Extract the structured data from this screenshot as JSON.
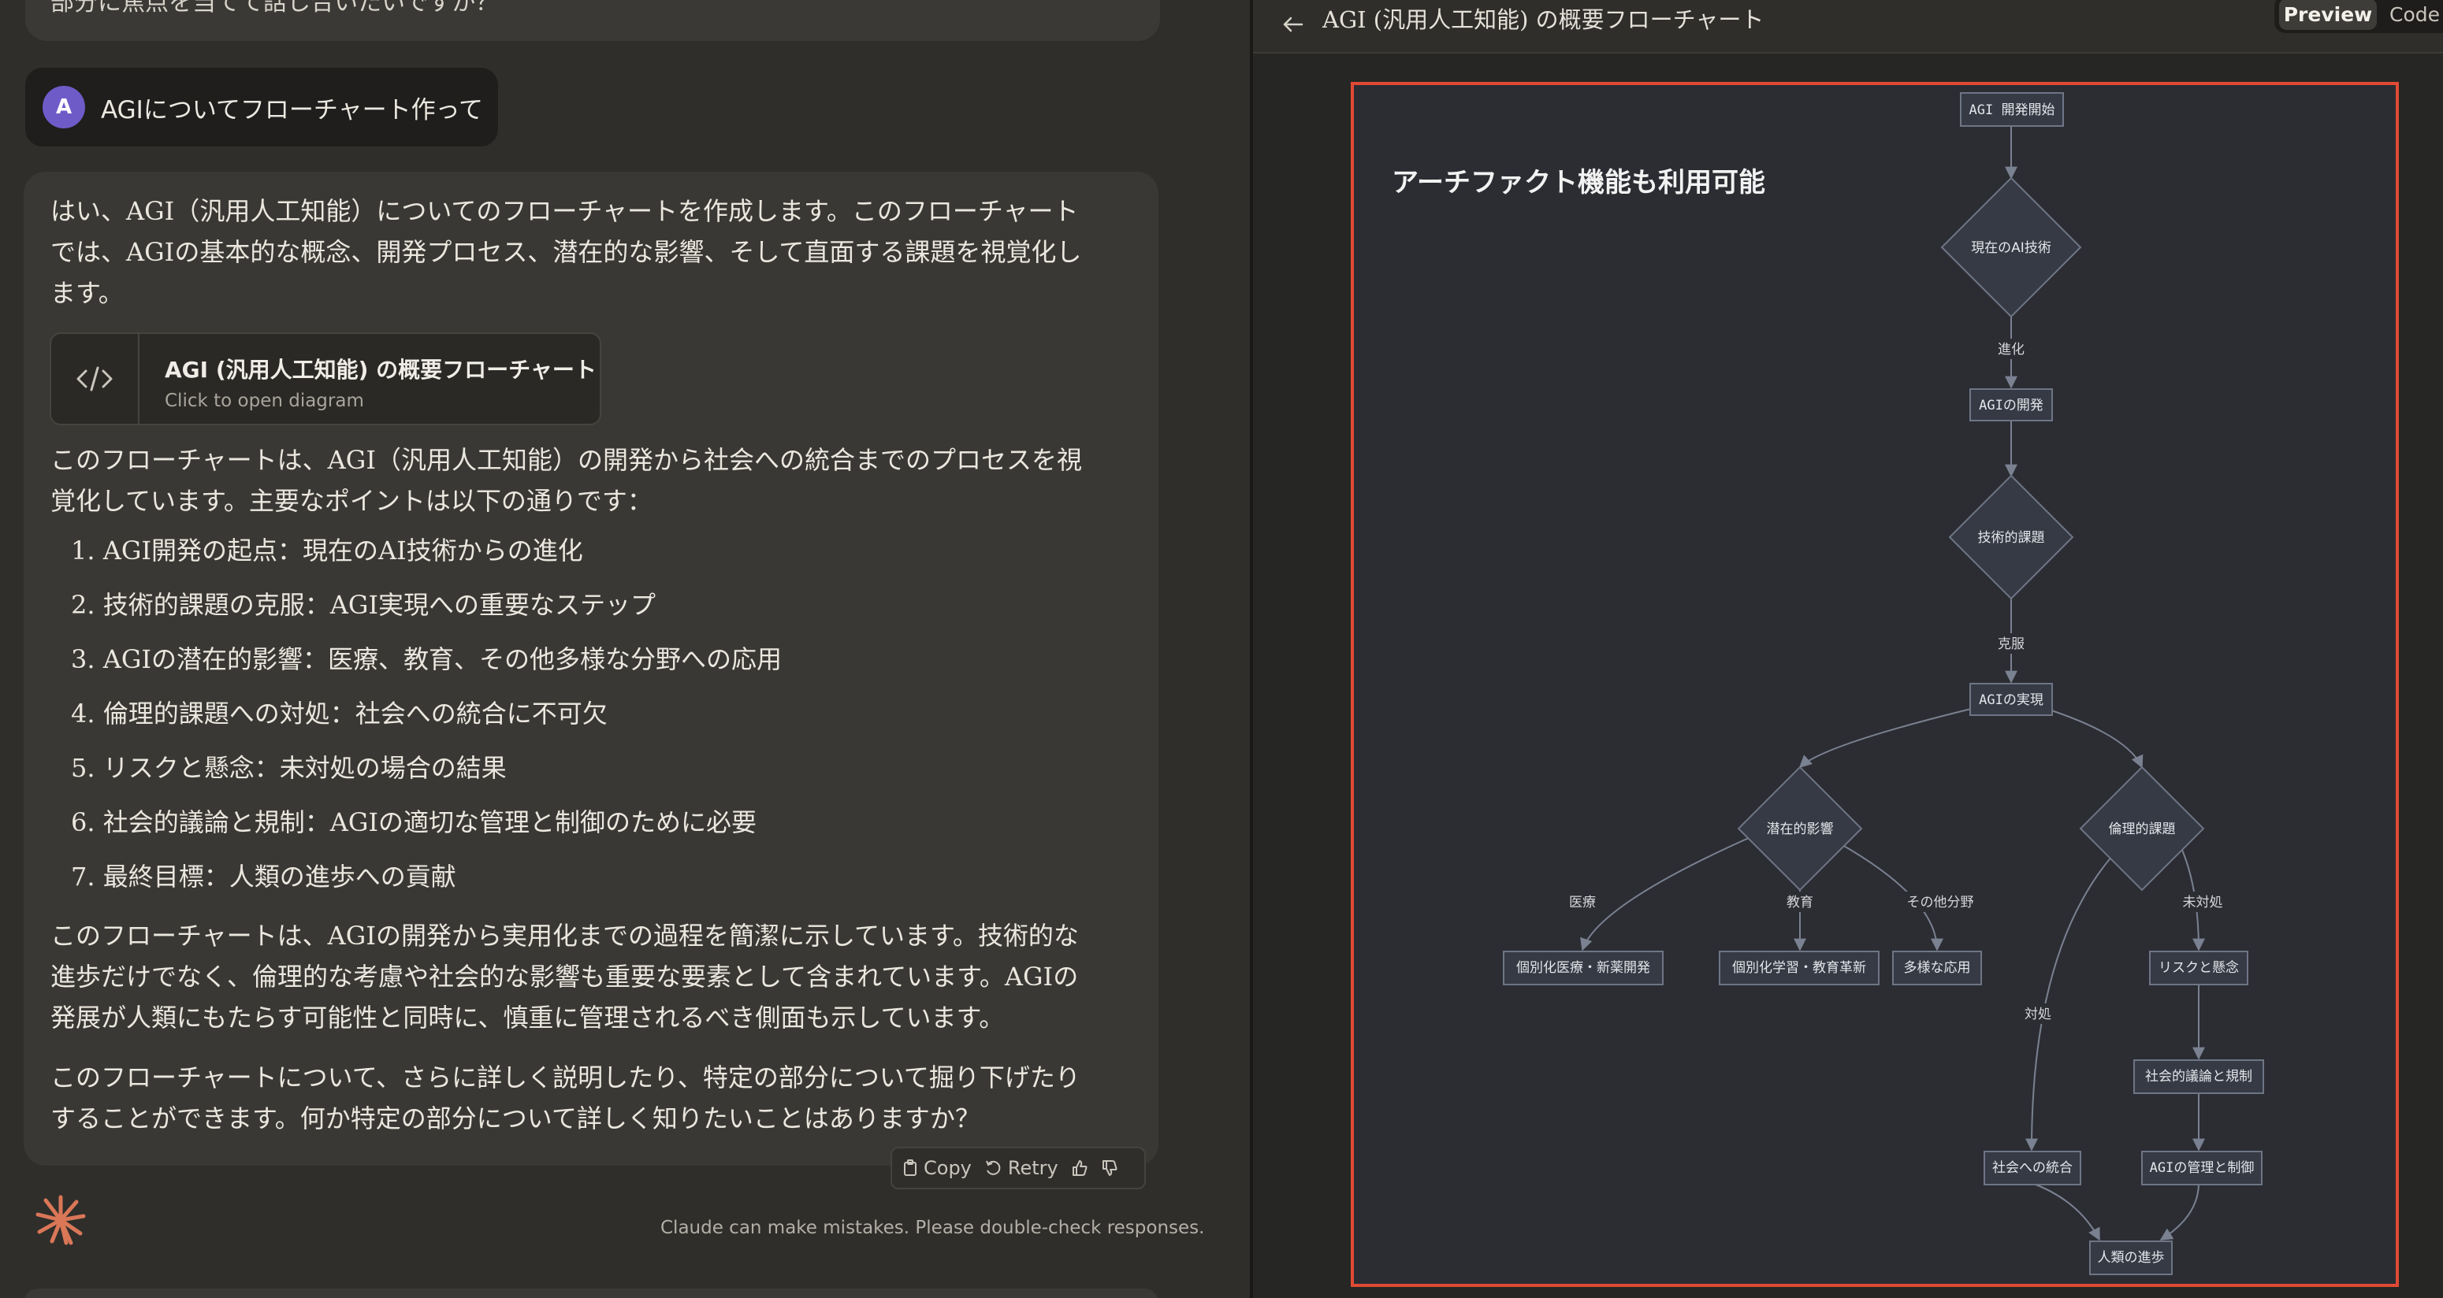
{
  "chat": {
    "previous_message_tail": "部分に焦点を当てて話し合いたいですか？",
    "user": {
      "avatar_initial": "A",
      "message": "AGIについてフローチャート作って"
    },
    "assistant": {
      "intro_lines": [
        "はい、AGI（汎用人工知能）についてのフローチャートを作成します。このフローチャート",
        "では、AGIの基本的な概念、開発プロセス、潜在的な影響、そして直面する課題を視覚化し",
        "ます。"
      ],
      "artifact": {
        "title": "AGI (汎用人工知能) の概要フローチャート",
        "subtitle": "Click to open diagram"
      },
      "summary_lines": [
        "このフローチャートは、AGI（汎用人工知能）の開発から社会への統合までのプロセスを視",
        "覚化しています。主要なポイントは以下の通りです："
      ],
      "points": [
        "1. AGI開発の起点：現在のAI技術からの進化",
        "2. 技術的課題の克服：AGI実現への重要なステップ",
        "3. AGIの潜在的影響：医療、教育、その他多様な分野への応用",
        "4. 倫理的課題への対処：社会への統合に不可欠",
        "5. リスクと懸念：未対処の場合の結果",
        "6. 社会的議論と規制：AGIの適切な管理と制御のために必要",
        "7. 最終目標：人類の進歩への貢献"
      ],
      "conclusion_lines": [
        "このフローチャートは、AGIの開発から実用化までの過程を簡潔に示しています。技術的な",
        "進歩だけでなく、倫理的な考慮や社会的な影響も重要な要素として含まれています。AGIの",
        "発展が人類にもたらす可能性と同時に、慎重に管理されるべき側面も示しています。"
      ],
      "closing_lines": [
        "このフローチャートについて、さらに詳しく説明したり、特定の部分について掘り下げたり",
        "することができます。何か特定の部分について詳しく知りたいことはありますか？"
      ]
    },
    "actions": {
      "copy": "Copy",
      "retry": "Retry"
    },
    "disclaimer": "Claude can make mistakes. Please double-check responses."
  },
  "artifact_pane": {
    "title": "AGI (汎用人工知能) の概要フローチャート",
    "tabs": {
      "preview": "Preview",
      "code": "Code"
    },
    "overlay_heading": "アーチファクト機能も利用可能",
    "nodes": {
      "start": "AGI 開発開始",
      "current_ai": "現在のAI技術",
      "agi_dev": "AGIの開発",
      "tech_issues": "技術的課題",
      "agi_real": "AGIの実現",
      "potential": "潜在的影響",
      "ethics": "倫理的課題",
      "medical": "個別化医療・新薬開発",
      "education": "個別化学習・教育革新",
      "various": "多様な応用",
      "risks": "リスクと懸念",
      "regulation": "社会的議論と規制",
      "control": "AGIの管理と制御",
      "integration": "社会への統合",
      "progress": "人類の進歩"
    },
    "edge_labels": {
      "evolve": "進化",
      "overcome": "克服",
      "medical": "医療",
      "education": "教育",
      "other": "その他分野",
      "unaddressed": "未対処",
      "address": "対処"
    },
    "colors": {
      "frame": "#e04a34",
      "node_fill": "#363a45",
      "edge": "#7a8190"
    }
  }
}
